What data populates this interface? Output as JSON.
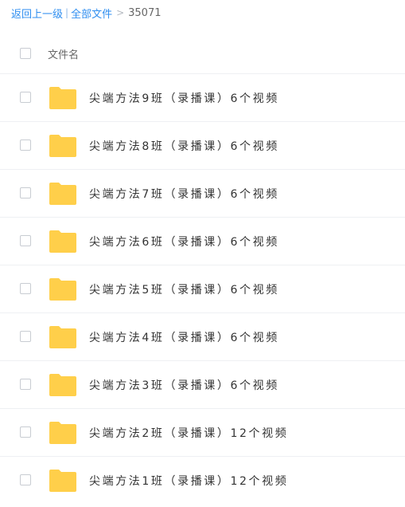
{
  "breadcrumb": {
    "back": "返回上一级",
    "divider": "|",
    "all_files": "全部文件",
    "arrow": ">",
    "current": "35071"
  },
  "list_header": {
    "name_column": "文件名"
  },
  "folder_color": "#FFCF4A",
  "files": [
    {
      "name": "尖端方法9班（录播课）6个视频",
      "icon": "folder-icon"
    },
    {
      "name": "尖端方法8班（录播课）6个视频",
      "icon": "folder-icon"
    },
    {
      "name": "尖端方法7班（录播课）6个视频",
      "icon": "folder-icon"
    },
    {
      "name": "尖端方法6班（录播课）6个视频",
      "icon": "folder-icon"
    },
    {
      "name": "尖端方法5班（录播课）6个视频",
      "icon": "folder-icon"
    },
    {
      "name": "尖端方法4班（录播课）6个视频",
      "icon": "folder-icon"
    },
    {
      "name": "尖端方法3班（录播课）6个视频",
      "icon": "folder-icon"
    },
    {
      "name": "尖端方法2班（录播课）12个视频",
      "icon": "folder-icon"
    },
    {
      "name": "尖端方法1班（录播课）12个视频",
      "icon": "folder-icon"
    }
  ]
}
